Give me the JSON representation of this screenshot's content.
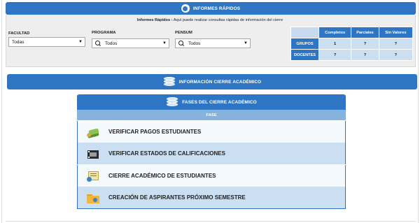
{
  "header": {
    "title": "INFORMES RÁPIDOS"
  },
  "note": {
    "bold": "Informes Rápidos :",
    "text": " Aquí puede realizar consultas rápidas de información del cierre"
  },
  "filters": {
    "facultad": {
      "label": "FACULTAD",
      "value": "Todas"
    },
    "programa": {
      "label": "PROGRAMA",
      "value": "Todos"
    },
    "pensum": {
      "label": "PENSUM",
      "value": "Todos"
    }
  },
  "stats": {
    "columns": [
      "Completos",
      "Parciales",
      "Sin Valores"
    ],
    "rows": [
      {
        "label": "GRUPOS",
        "values": [
          "1",
          "?",
          "?"
        ]
      },
      {
        "label": "DOCENTES",
        "values": [
          "?",
          "?",
          "?"
        ]
      }
    ]
  },
  "info_bar": {
    "title": "INFORMACIÓN CIERRE ACADÉMICO"
  },
  "fases": {
    "title": "FASES DEL CIERRE ACADÉMICO",
    "column": "FASE",
    "items": [
      {
        "label": "VERIFICAR PAGOS ESTUDIANTES",
        "icon": "money-icon"
      },
      {
        "label": "VERIFICAR ESTADOS DE CALIFICACIONES",
        "icon": "film-icon"
      },
      {
        "label": "CIERRE ACADÉMICO DE ESTUDIANTES",
        "icon": "certificate-icon"
      },
      {
        "label": "CREACIÓN DE ASPIRANTES PRÓXIMO SEMESTRE",
        "icon": "folder-user-icon"
      }
    ]
  },
  "colors": {
    "primary": "#2e76c4",
    "row_alt": "#cadff1",
    "panel": "#eeeeee"
  }
}
